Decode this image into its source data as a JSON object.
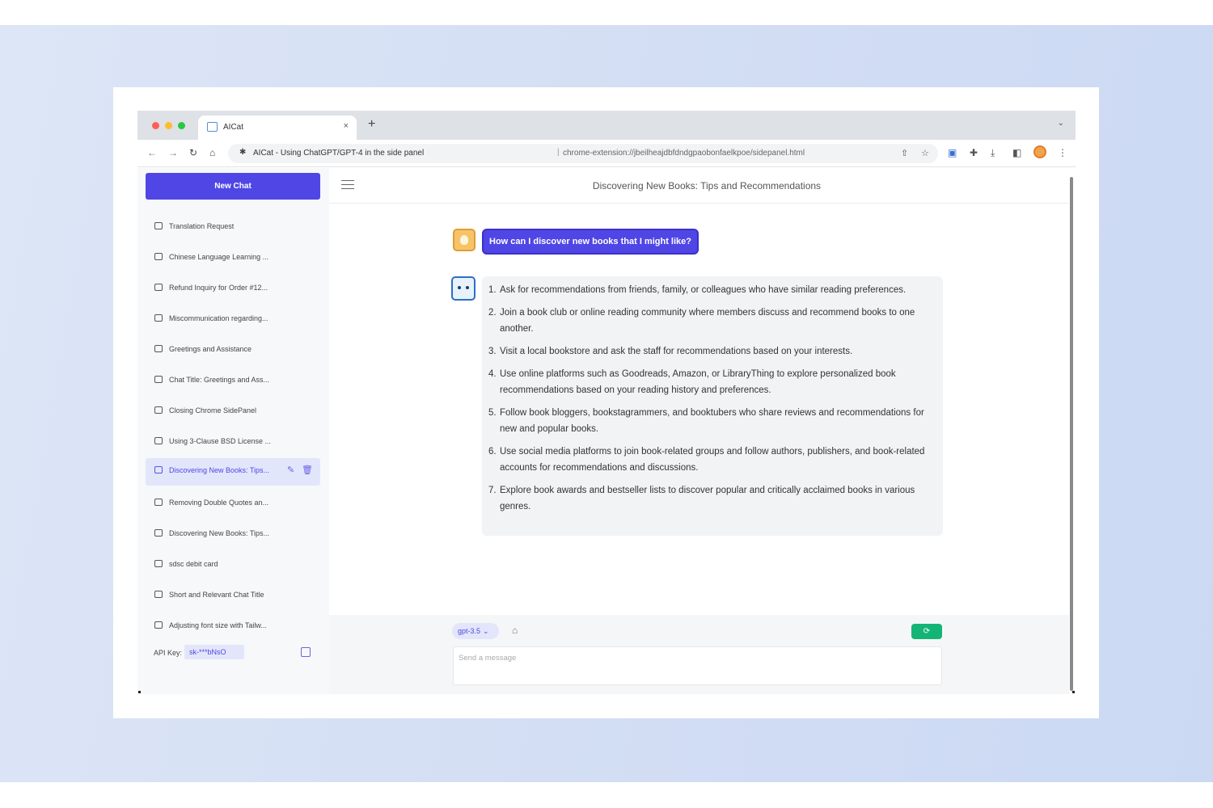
{
  "browser": {
    "tab_title": "AICat",
    "tab_close": "×",
    "new_tab": "+",
    "tab_menu": "⌄",
    "page_title": "AICat - Using ChatGPT/GPT-4 in the side panel",
    "url_sep": "|",
    "url": "chrome-extension://jbeilheajdbfdndgpaobonfaelkpoe/sidepanel.html",
    "icons": [
      "back-icon",
      "forward-icon",
      "reload-icon",
      "home-icon",
      "site-info-icon",
      "share-icon",
      "bookmark-star-icon",
      "extension-aicat-icon",
      "extensions-puzzle-icon",
      "download-icon",
      "side-panel-icon",
      "profile-avatar",
      "more-menu-icon"
    ]
  },
  "sidebar": {
    "new_chat_label": "New Chat",
    "items": [
      {
        "label": "Translation Request"
      },
      {
        "label": "Chinese Language Learning ..."
      },
      {
        "label": "Refund Inquiry for Order #12..."
      },
      {
        "label": "Miscommunication regarding..."
      },
      {
        "label": "Greetings and Assistance"
      },
      {
        "label": "Chat Title: Greetings and Ass..."
      },
      {
        "label": "Closing Chrome SidePanel"
      },
      {
        "label": "Using 3-Clause BSD License ..."
      },
      {
        "label": "Discovering New Books: Tips...",
        "active": true
      },
      {
        "label": "Removing Double Quotes an..."
      },
      {
        "label": "Discovering New Books: Tips..."
      },
      {
        "label": "sdsc debit card"
      },
      {
        "label": "Short and Relevant Chat Title"
      },
      {
        "label": "Adjusting font size with Tailw..."
      }
    ],
    "api_key_label": "API Key:",
    "api_key_value": "sk-***bNsO"
  },
  "chat": {
    "title": "Discovering New Books: Tips and Recommendations",
    "user_message": "How can I discover new books that I might like?",
    "bot_items": [
      {
        "num": "1.",
        "text": "Ask for recommendations from friends, family, or colleagues who have similar reading preferences."
      },
      {
        "num": "2.",
        "text": "Join a book club or online reading community where members discuss and recommend books to one another."
      },
      {
        "num": "3.",
        "text": "Visit a local bookstore and ask the staff for recommendations based on your interests."
      },
      {
        "num": "4.",
        "text": "Use online platforms such as Goodreads, Amazon, or LibraryThing to explore personalized book recommendations based on your reading history and preferences."
      },
      {
        "num": "5.",
        "text": "Follow book bloggers, bookstagrammers, and booktubers who share reviews and recommendations for new and popular books."
      },
      {
        "num": "6.",
        "text": "Use social media platforms to join book-related groups and follow authors, publishers, and book-related accounts for recommendations and discussions."
      },
      {
        "num": "7.",
        "text": "Explore book awards and bestseller lists to discover popular and critically acclaimed books in various genres."
      }
    ]
  },
  "composer": {
    "model": "gpt-3.5",
    "placeholder": "Send a message",
    "value": ""
  },
  "colors": {
    "accent": "#4f46e5",
    "send": "#14b574",
    "backdrop": "#d3def4"
  }
}
